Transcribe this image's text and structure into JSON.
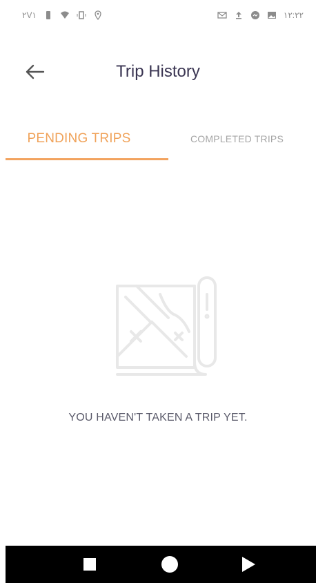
{
  "status_bar": {
    "left_text": "۲V۱",
    "time": "۱۲:۲۲",
    "icons_left": [
      "battery-icon",
      "wifi-icon",
      "vibrate-icon",
      "location-icon"
    ],
    "icons_right": [
      "mail-icon",
      "upload-icon",
      "messenger-icon",
      "gallery-icon"
    ]
  },
  "header": {
    "title": "Trip History",
    "back_icon": "arrow-left-icon"
  },
  "tabs": [
    {
      "label": "PENDING TRIPS",
      "active": true
    },
    {
      "label": "COMPLETED TRIPS",
      "active": false
    }
  ],
  "empty_state": {
    "icon": "map-icon",
    "message": "YOU HAVEN'T TAKEN A TRIP YET."
  },
  "nav_bar": {
    "buttons": [
      "recents-icon",
      "home-icon",
      "back-triangle-icon"
    ]
  },
  "colors": {
    "accent": "#f2a35f",
    "title": "#3a3552",
    "inactive_tab": "#a5a5a5"
  }
}
